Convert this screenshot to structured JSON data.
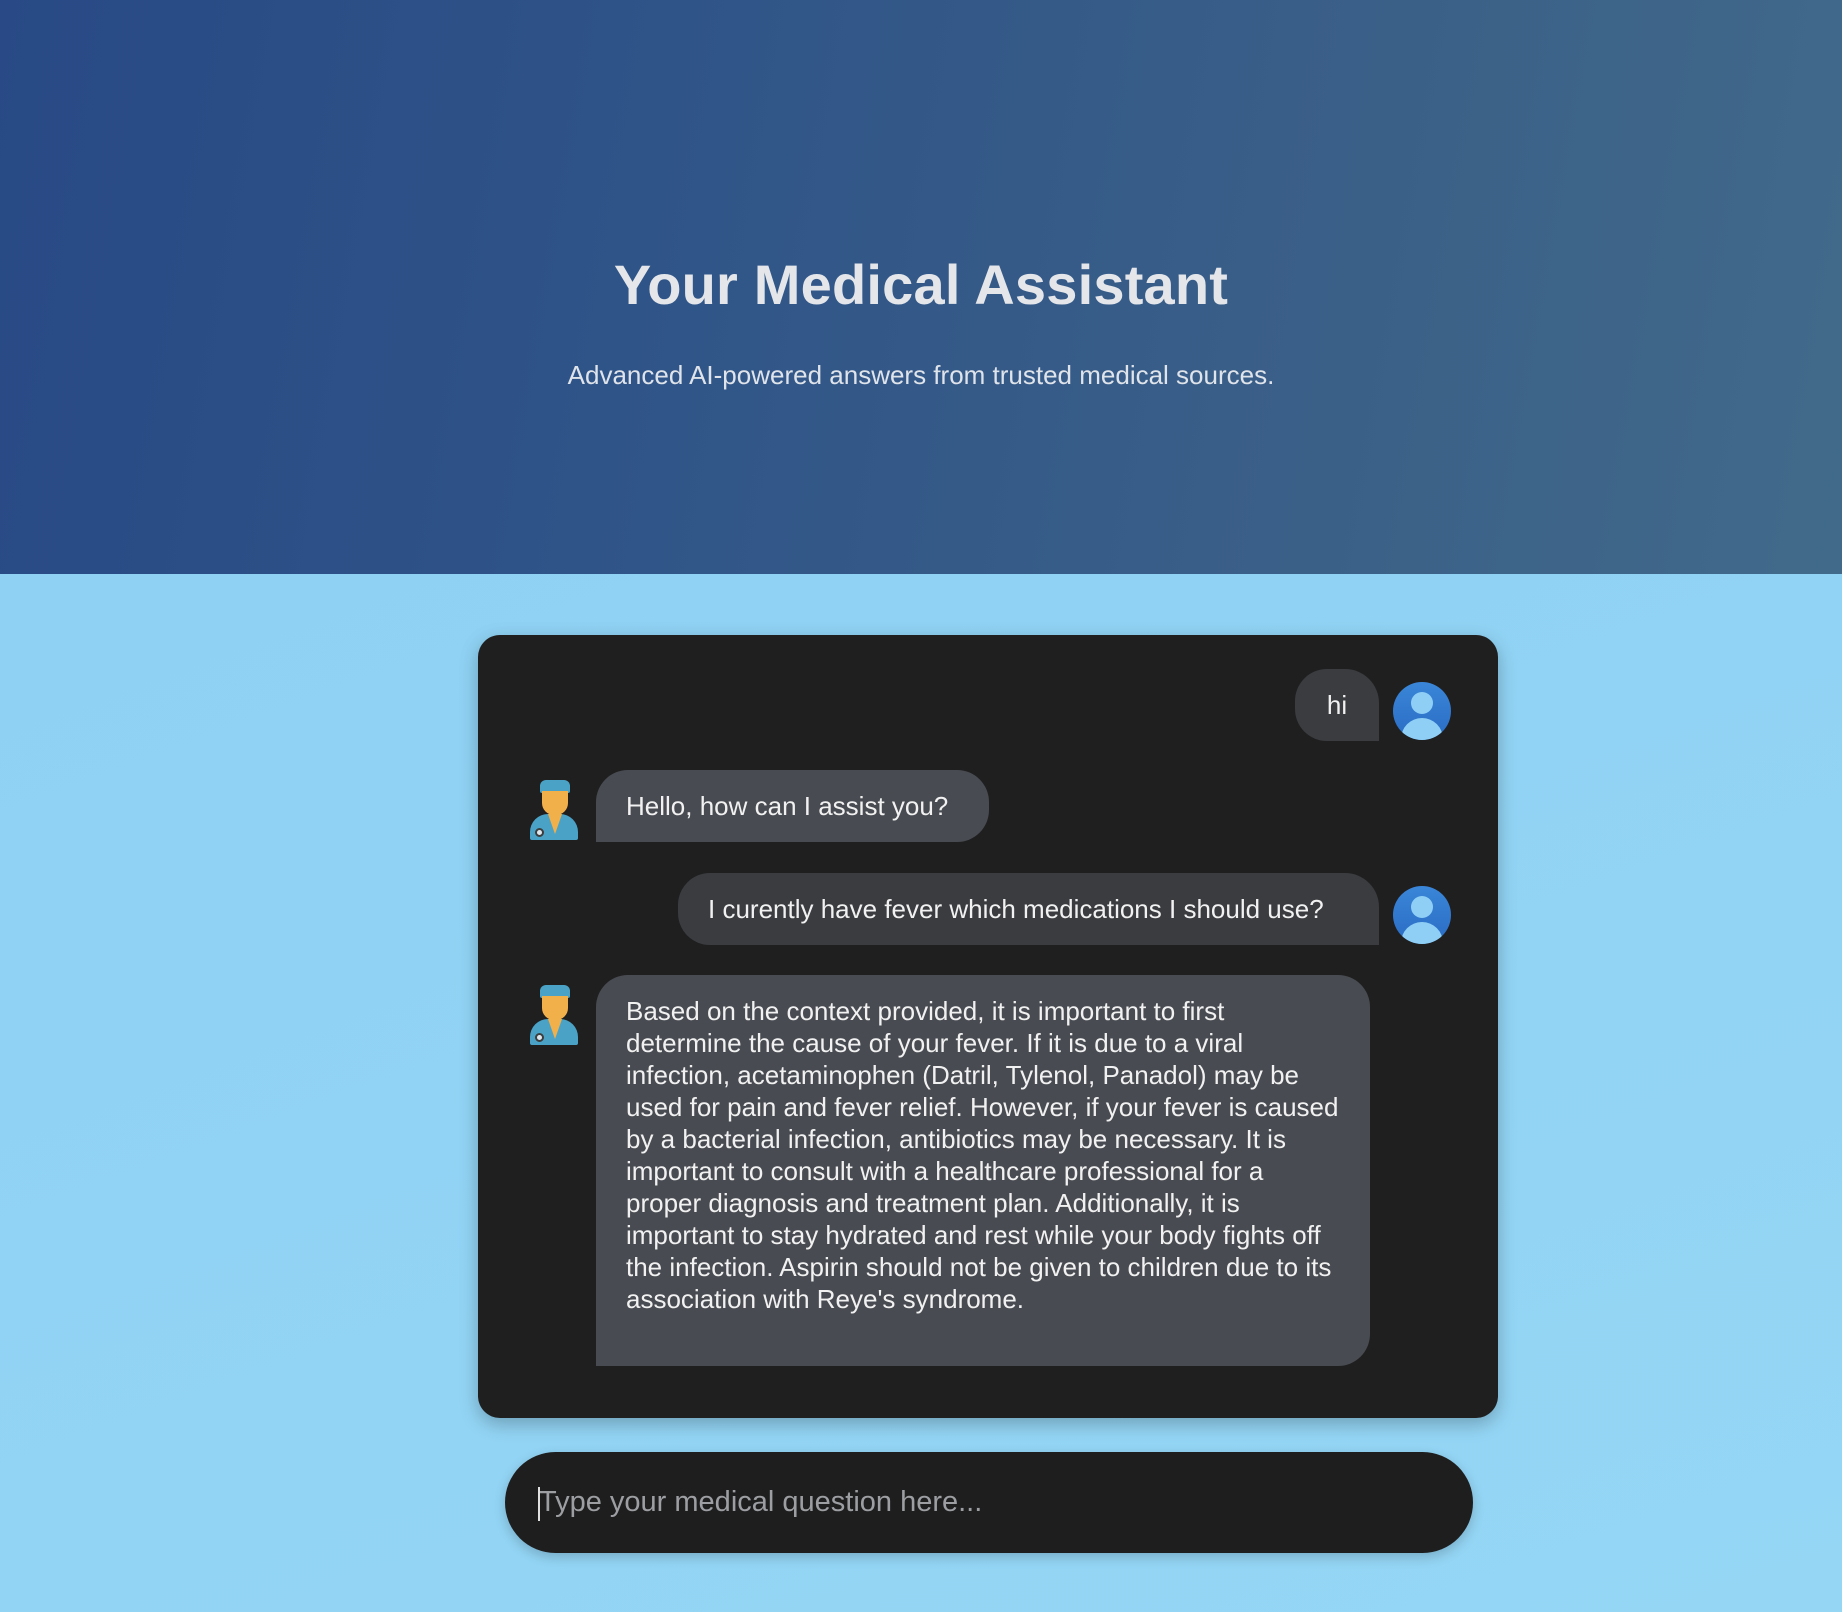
{
  "hero": {
    "title": "Your Medical Assistant",
    "subtitle": "Advanced AI-powered answers from trusted medical sources."
  },
  "chat": {
    "messages": [
      {
        "role": "user",
        "text": "hi"
      },
      {
        "role": "assistant",
        "text": "Hello, how can I assist you?"
      },
      {
        "role": "user",
        "text": "I curently have fever which medications I should use?"
      },
      {
        "role": "assistant",
        "text": "Based on the context provided, it is important to first determine the cause of your fever. If it is due to a viral infection, acetaminophen (Datril, Tylenol, Panadol) may be used for pain and fever relief. However, if your fever is caused by a bacterial infection, antibiotics may be necessary. It is important to consult with a healthcare professional for a proper diagnosis and treatment plan. Additionally, it is important to stay hydrated and rest while your body fights off the infection. Aspirin should not be given to children due to its association with Reye's syndrome."
      }
    ],
    "icons": {
      "user_avatar": "user-avatar-icon",
      "assistant_avatar": "doctor-icon"
    }
  },
  "input": {
    "placeholder": "Type your medical question here...",
    "value": ""
  },
  "colors": {
    "hero_bg": "#2f5488",
    "page_bg": "#8ccff2",
    "panel_bg": "#1f1f20",
    "bot_bubble": "#484b51",
    "user_bubble": "#3a3c40",
    "avatar_blue": "#2a6cc4"
  }
}
